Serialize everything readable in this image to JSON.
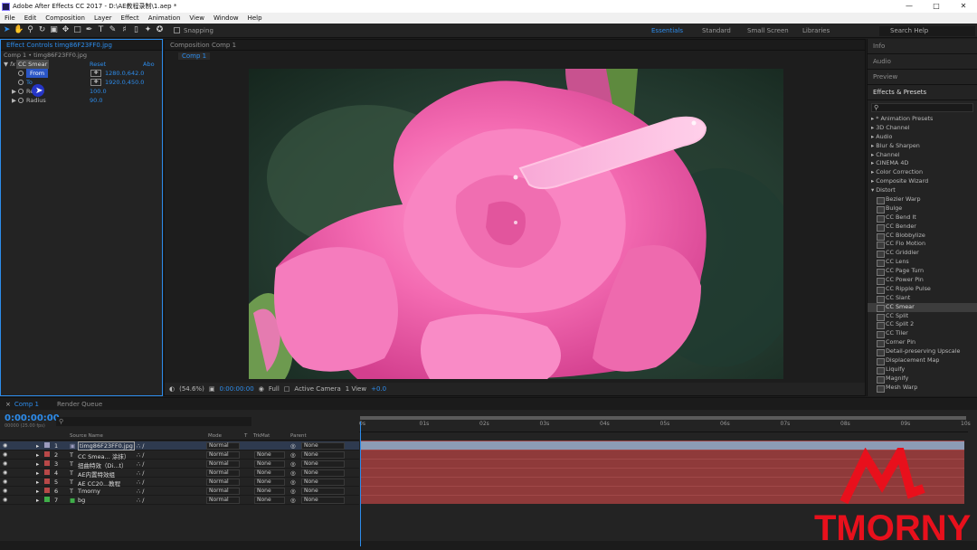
{
  "title": "Adobe After Effects CC 2017 - D:\\AE教程录制\\1.aep *",
  "menu": [
    "File",
    "Edit",
    "Composition",
    "Layer",
    "Effect",
    "Animation",
    "View",
    "Window",
    "Help"
  ],
  "toolbar": {
    "snapping_label": "Snapping"
  },
  "workspaces": [
    "Essentials",
    "Standard",
    "Small Screen",
    "Libraries"
  ],
  "search_help": "Search Help",
  "effect_controls": {
    "tab_label": "Effect Controls timg86F23FF0.jpg",
    "breadcrumb": "Comp 1 • timg86F23FF0.jpg",
    "effect_name": "CC Smear",
    "reset": "Reset",
    "about": "Abo",
    "props": [
      {
        "label": "From",
        "value": "1280.0,642.0"
      },
      {
        "label": "To",
        "value": "1920.0,450.0"
      },
      {
        "label": "Reach",
        "value": "100.0"
      },
      {
        "label": "Radius",
        "value": "90.0"
      }
    ]
  },
  "composition": {
    "tab_label": "Composition Comp 1",
    "subtab": "Comp 1",
    "footer": {
      "zoom": "(54.6%)",
      "time": "0:00:00:00",
      "resolution": "Full",
      "camera": "Active Camera",
      "views": "1 View",
      "exposure": "+0.0"
    }
  },
  "right_panel": {
    "sections": [
      "Info",
      "Audio",
      "Preview"
    ],
    "effects_title": "Effects & Presets",
    "categories": [
      "* Animation Presets",
      "3D Channel",
      "Audio",
      "Blur & Sharpen",
      "Channel",
      "CINEMA 4D",
      "Color Correction",
      "Composite Wizard"
    ],
    "open_category": "Distort",
    "distort_items": [
      "Bezier Warp",
      "Bulge",
      "CC Bend It",
      "CC Bender",
      "CC Blobbylize",
      "CC Flo Motion",
      "CC Griddler",
      "CC Lens",
      "CC Page Turn",
      "CC Power Pin",
      "CC Ripple Pulse",
      "CC Slant",
      "CC Smear",
      "CC Split",
      "CC Split 2",
      "CC Tiler",
      "Corner Pin",
      "Detail-preserving Upscale",
      "Displacement Map",
      "Liquify",
      "Magnify",
      "Mesh Warp"
    ],
    "selected": "CC Smear"
  },
  "timeline": {
    "tabs": [
      "Comp 1",
      "Render Queue"
    ],
    "timecode": "0:00:00:00",
    "timecode_sub": "00000 (25.00 fps)",
    "columns": [
      "Source Name",
      "Mode",
      "T",
      "TrkMat",
      "Parent"
    ],
    "ruler": [
      "0s",
      "01s",
      "02s",
      "03s",
      "04s",
      "05s",
      "06s",
      "07s",
      "08s",
      "09s",
      "10s"
    ],
    "layers": [
      {
        "num": "1",
        "type": "img",
        "name": "timg86F23FF0.jpg",
        "mode": "Normal",
        "trk": "",
        "parent": "None",
        "color": "#9b9bbd"
      },
      {
        "num": "2",
        "type": "T",
        "name": "CC Smea... 涂抹）",
        "mode": "Normal",
        "trk": "None",
        "parent": "None",
        "color": "#b84848"
      },
      {
        "num": "3",
        "type": "T",
        "name": "扭曲特效（Di...t）",
        "mode": "Normal",
        "trk": "None",
        "parent": "None",
        "color": "#b84848"
      },
      {
        "num": "4",
        "type": "T",
        "name": "AE内置特效组",
        "mode": "Normal",
        "trk": "None",
        "parent": "None",
        "color": "#b84848"
      },
      {
        "num": "5",
        "type": "T",
        "name": "AE CC20...教程",
        "mode": "Normal",
        "trk": "None",
        "parent": "None",
        "color": "#b84848"
      },
      {
        "num": "6",
        "type": "T",
        "name": "Tmorny",
        "mode": "Normal",
        "trk": "None",
        "parent": "None",
        "color": "#b84848"
      },
      {
        "num": "7",
        "type": "solid",
        "name": "bg",
        "mode": "Normal",
        "trk": "None",
        "parent": "None",
        "color": "#3fae49"
      }
    ]
  },
  "watermark": "TMORNY"
}
